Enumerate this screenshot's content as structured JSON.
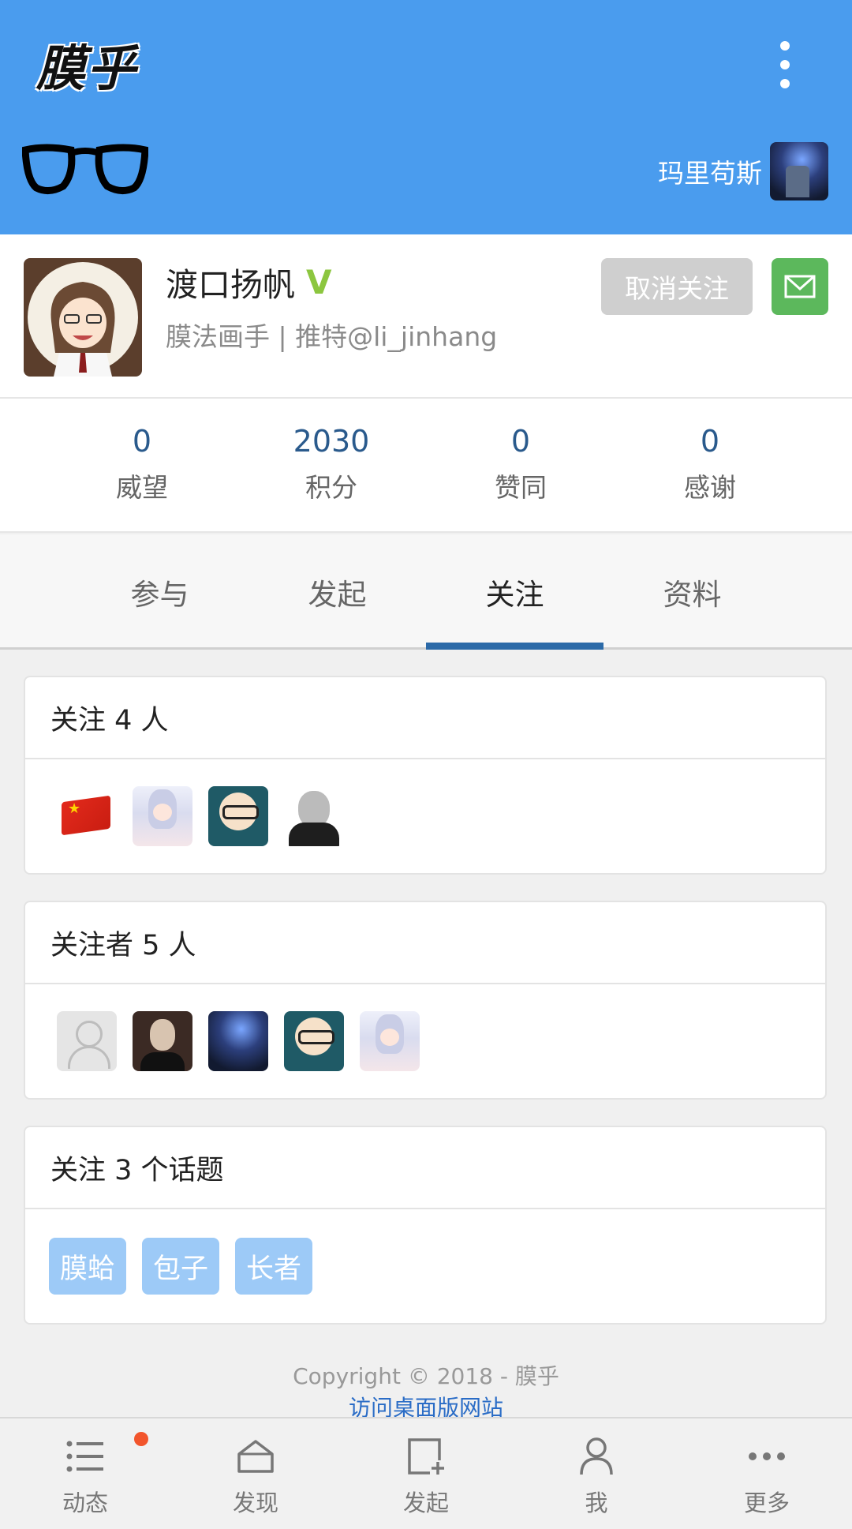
{
  "header": {
    "logo": "膜乎",
    "username": "玛里苟斯",
    "menu_icon": "more-vertical-icon",
    "bg_color": "#4a9cee"
  },
  "profile": {
    "name": "渡口扬帆",
    "verified_mark": "V",
    "bio": "膜法画手 | 推特@li_jinhang",
    "unfollow_label": "取消关注",
    "message_icon": "mail-icon"
  },
  "stats": [
    {
      "value": "0",
      "label": "威望"
    },
    {
      "value": "2030",
      "label": "积分"
    },
    {
      "value": "0",
      "label": "赞同"
    },
    {
      "value": "0",
      "label": "感谢"
    }
  ],
  "tabs": [
    {
      "label": "参与"
    },
    {
      "label": "发起"
    },
    {
      "label": "关注",
      "active": true
    },
    {
      "label": "资料"
    }
  ],
  "following": {
    "title": "关注 4 人"
  },
  "followers": {
    "title": "关注者 5 人"
  },
  "topics": {
    "title": "关注 3 个话题",
    "tags": [
      "膜蛤",
      "包子",
      "长者"
    ]
  },
  "footer": {
    "copyright": "Copyright © 2018 - 膜乎",
    "desktop_link": "访问桌面版网站"
  },
  "bottom_nav": [
    {
      "label": "动态",
      "icon": "list-icon",
      "has_badge": true
    },
    {
      "label": "发现",
      "icon": "home-icon"
    },
    {
      "label": "发起",
      "icon": "new-post-icon"
    },
    {
      "label": "我",
      "icon": "user-icon"
    },
    {
      "label": "更多",
      "icon": "more-horizontal-icon"
    }
  ]
}
